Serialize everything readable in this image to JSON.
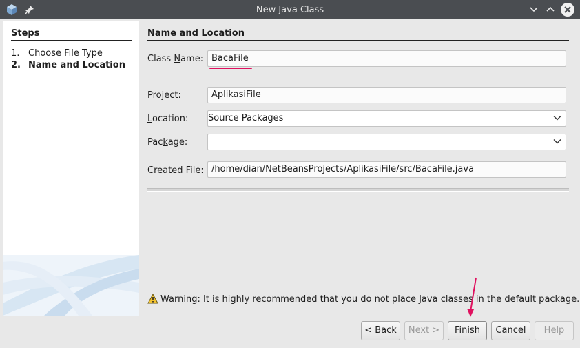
{
  "window": {
    "title": "New Java Class",
    "minimize_glyph": "⌄",
    "maximize_glyph": "⌃",
    "close_glyph": "✕"
  },
  "steps": {
    "title": "Steps",
    "items": [
      {
        "num": "1.",
        "label": "Choose File Type"
      },
      {
        "num": "2.",
        "label": "Name and Location"
      }
    ]
  },
  "section": {
    "title": "Name and Location"
  },
  "form": {
    "class_name": {
      "label_pre": "Class ",
      "label_mnemonic": "N",
      "label_post": "ame:",
      "value": "BacaFile"
    },
    "project": {
      "label_pre": "",
      "label_mnemonic": "P",
      "label_post": "roject:",
      "value": "AplikasiFile"
    },
    "location": {
      "label_pre": "",
      "label_mnemonic": "L",
      "label_post": "ocation:",
      "value": "Source Packages"
    },
    "package": {
      "label_pre": "Pac",
      "label_mnemonic": "k",
      "label_post": "age:",
      "value": ""
    },
    "created_file": {
      "label_pre": "",
      "label_mnemonic": "C",
      "label_post": "reated File:",
      "value": "/home/dian/NetBeansProjects/AplikasiFile/src/BacaFile.java"
    }
  },
  "warning": {
    "text": "Warning: It is highly recommended that you do not place Java classes in the default package."
  },
  "buttons": {
    "back": {
      "pre": "< ",
      "mnemonic": "B",
      "post": "ack"
    },
    "next": {
      "label": "Next >"
    },
    "finish": {
      "pre": "",
      "mnemonic": "F",
      "post": "inish"
    },
    "cancel": {
      "label": "Cancel"
    },
    "help": {
      "label": "Help"
    }
  },
  "colors": {
    "titlebar": "#4a4d51",
    "annotation": "#e0115f"
  },
  "icons": {
    "app": "java-cube-icon",
    "pin": "pin-icon",
    "warning": "warning-icon",
    "dropdown": "chevron-down-icon"
  }
}
